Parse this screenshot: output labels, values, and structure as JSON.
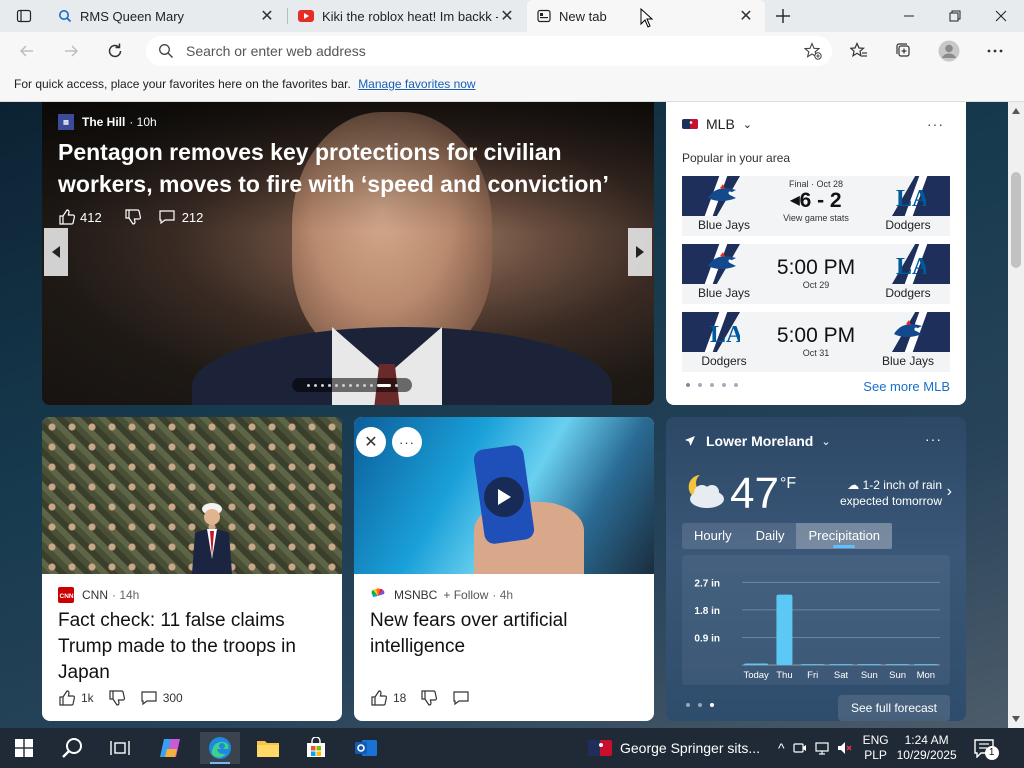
{
  "browser": {
    "tabs": [
      {
        "title": "RMS Queen Mary",
        "icon": "search-icon"
      },
      {
        "title": "Kiki the roblox heat! Im backk - Y",
        "icon": "youtube-icon"
      },
      {
        "title": "New tab",
        "icon": "new-tab-icon"
      }
    ],
    "address_placeholder": "Search or enter web address",
    "favorites_prompt": "For quick access, place your favorites here on the favorites bar.",
    "favorites_link": "Manage favorites now"
  },
  "hero": {
    "source": "The Hill",
    "time": "· 10h",
    "headline": "Pentagon removes key protections for civilian workers, moves to fire with ‘speed and conviction’",
    "likes": "412",
    "comments": "212",
    "slide_index": 11,
    "slide_count": 12
  },
  "mlb": {
    "title": "MLB",
    "subtitle": "Popular in your area",
    "games": [
      {
        "left_team": "Blue Jays",
        "right_team": "Dodgers",
        "top": "Final · Oct 28",
        "main": "6 - 2",
        "bottom": "View game stats",
        "left_logo": "blue-jays-logo",
        "right_logo": "dodgers-logo"
      },
      {
        "left_team": "Blue Jays",
        "right_team": "Dodgers",
        "top": "",
        "main": "5:00 PM",
        "bottom": "Oct 29",
        "left_logo": "blue-jays-logo",
        "right_logo": "dodgers-logo"
      },
      {
        "left_team": "Dodgers",
        "right_team": "Blue Jays",
        "top": "",
        "main": "5:00 PM",
        "bottom": "Oct 31",
        "left_logo": "dodgers-logo",
        "right_logo": "blue-jays-logo"
      }
    ],
    "see_more": "See more MLB"
  },
  "cards": [
    {
      "source": "CNN",
      "time": "· 14h",
      "headline": "Fact check: 11 false claims Trump made to the troops in Japan",
      "likes": "1k",
      "comments": "300"
    },
    {
      "source": "MSNBC",
      "follow": "Follow",
      "time": "· 4h",
      "headline": "New fears over artificial intelligence",
      "likes": "18",
      "comments": ""
    }
  ],
  "weather": {
    "location": "Lower Moreland",
    "temp": "47",
    "unit": "°F",
    "forecast_line1": "1-2 inch of rain",
    "forecast_line2": "expected tomorrow",
    "tabs": [
      "Hourly",
      "Daily",
      "Precipitation"
    ],
    "active_tab": "Precipitation",
    "see_full": "See full forecast"
  },
  "chart_data": {
    "type": "bar",
    "categories": [
      "Today",
      "Thu",
      "Fri",
      "Sat",
      "Sun",
      "Sun",
      "Mon"
    ],
    "values": [
      0.05,
      2.3,
      0.03,
      0.03,
      0.03,
      0.03,
      0.03
    ],
    "ylabel": "",
    "ytick_labels": [
      "2.7 in",
      "1.8 in",
      "0.9 in"
    ],
    "yticks": [
      2.7,
      1.8,
      0.9
    ],
    "ylim": [
      0,
      3.2
    ],
    "bar_color": "#5cc8f5"
  },
  "taskbar": {
    "news_ticker": "George Springer sits...",
    "lang1": "ENG",
    "lang2": "PLP",
    "time": "1:24 AM",
    "date": "10/29/2025",
    "notifications": "1"
  },
  "colors": {
    "accent": "#1a6fc8",
    "tab_bar": "#e8ebee",
    "toolbar": "#f7f7f7",
    "taskbar": "#1f2a36"
  }
}
